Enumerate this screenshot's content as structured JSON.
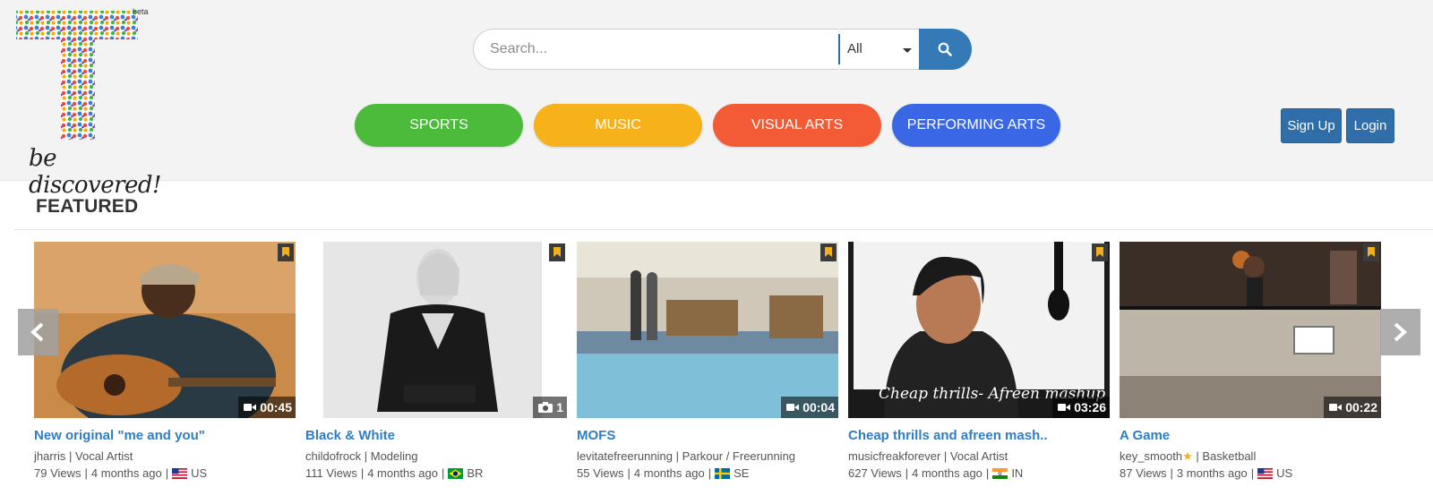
{
  "header": {
    "logo": {
      "letter": "T",
      "beta": "beta",
      "tagline": "be discovered!"
    },
    "search": {
      "placeholder": "Search...",
      "filter_value": "All",
      "button_icon": "search-icon"
    },
    "categories": [
      {
        "label": "SPORTS",
        "color": "#4cbb3c"
      },
      {
        "label": "MUSIC",
        "color": "#f7b21b"
      },
      {
        "label": "VISUAL ARTS",
        "color": "#f25b35"
      },
      {
        "label": "PERFORMING ARTS",
        "color": "#3a67e6"
      }
    ],
    "auth": {
      "signup": "Sign Up",
      "login": "Login"
    }
  },
  "featured": {
    "title": "FEATURED",
    "items": [
      {
        "title": "New original \"me and you\"",
        "user": "jharris",
        "category": "Vocal Artist",
        "views": "79 Views",
        "age": "4 months ago",
        "country": "US",
        "media_type": "video",
        "duration": "00:45"
      },
      {
        "title": "Black & White",
        "user": "childofrock",
        "category": "Modeling",
        "views": "111 Views",
        "age": "4 months ago",
        "country": "BR",
        "media_type": "photo",
        "duration": "1"
      },
      {
        "title": "MOFS",
        "user": "levitatefreerunning",
        "category": "Parkour / Freerunning",
        "views": "55 Views",
        "age": "4 months ago",
        "country": "SE",
        "media_type": "video",
        "duration": "00:04"
      },
      {
        "title": "Cheap thrills and afreen mash..",
        "user": "musicfreakforever",
        "category": "Vocal Artist",
        "views": "627 Views",
        "age": "4 months ago",
        "country": "IN",
        "media_type": "video",
        "duration": "03:26",
        "overlay_text": "Cheap thrills- Afreen mashup"
      },
      {
        "title": "A Game",
        "user": "key_smooth",
        "category": "Basketball",
        "views": "87 Views",
        "age": "3 months ago",
        "country": "US",
        "media_type": "video",
        "duration": "00:22",
        "user_badge": "star-icon"
      }
    ]
  },
  "colors": {
    "link": "#2f7dc7",
    "primary_button": "#337ab7",
    "bookmark": "#f2b01e"
  }
}
